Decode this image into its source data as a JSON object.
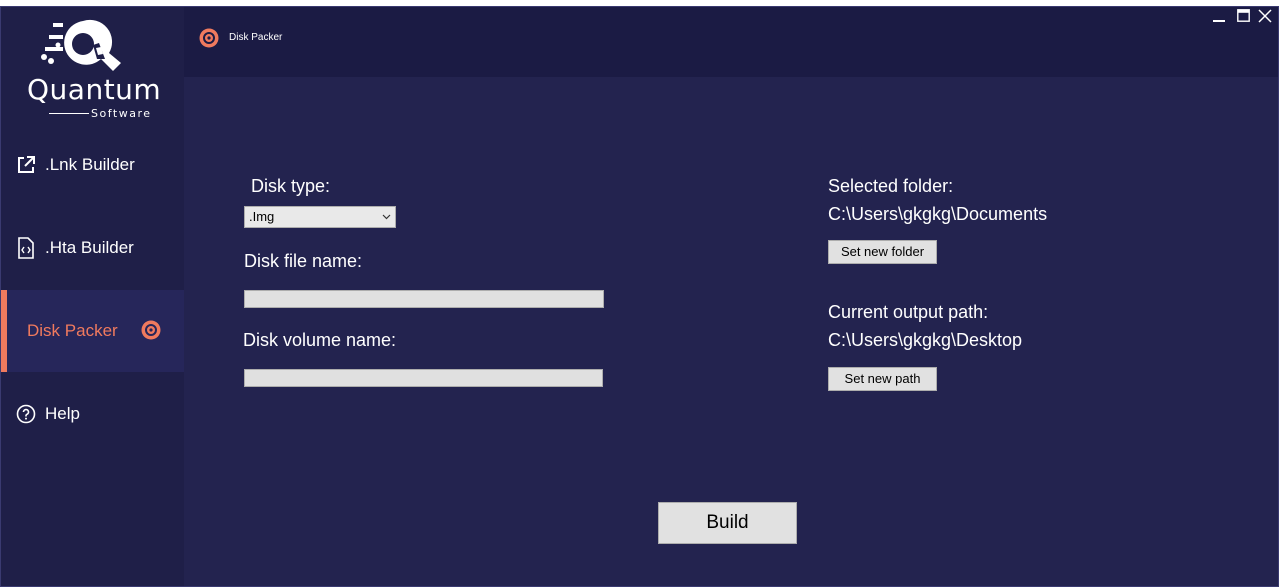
{
  "brand": {
    "name": "Quantum",
    "subtitle": "Software"
  },
  "sidebar": {
    "items": [
      {
        "label": ".Lnk Builder",
        "icon": "external-link-icon"
      },
      {
        "label": ".Hta Builder",
        "icon": "code-file-icon"
      },
      {
        "label": "Disk Packer",
        "icon": "disc-icon",
        "active": true
      },
      {
        "label": "Help",
        "icon": "help-circle-icon"
      }
    ]
  },
  "header": {
    "title": "Disk Packer"
  },
  "form": {
    "disk_type_label": "Disk type:",
    "disk_type_value": ".Img",
    "disk_file_name_label": "Disk file name:",
    "disk_file_name_value": "",
    "disk_volume_name_label": "Disk volume name:",
    "disk_volume_name_value": ""
  },
  "folder": {
    "selected_label": "Selected folder:",
    "selected_value": "C:\\Users\\gkgkg\\Documents",
    "set_folder_button": "Set new folder",
    "output_label": "Current output path:",
    "output_value": "C:\\Users\\gkgkg\\Desktop",
    "set_path_button": "Set new path"
  },
  "actions": {
    "build_button": "Build"
  },
  "colors": {
    "background": "#23234f",
    "sidebar": "#1f1f48",
    "accent": "#f07a5e"
  }
}
